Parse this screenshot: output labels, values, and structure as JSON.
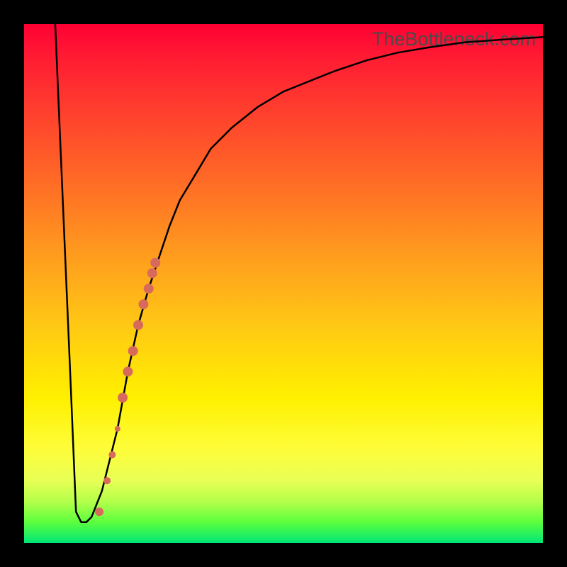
{
  "watermark": "TheBottleneck.com",
  "colors": {
    "frame": "#000000",
    "curve": "#000000",
    "marker": "#d86a5c"
  },
  "chart_data": {
    "type": "line",
    "title": "",
    "xlabel": "",
    "ylabel": "",
    "xlim": [
      0,
      100
    ],
    "ylim": [
      0,
      100
    ],
    "series": [
      {
        "name": "bottleneck-curve",
        "x": [
          6,
          9,
          10,
          11,
          12,
          13,
          15,
          18,
          20,
          22,
          24,
          26,
          28,
          30,
          33,
          36,
          40,
          45,
          50,
          55,
          60,
          66,
          72,
          78,
          85,
          92,
          100
        ],
        "values": [
          100,
          30,
          6,
          4,
          4,
          5,
          10,
          22,
          33,
          42,
          49,
          55,
          61,
          66,
          71,
          76,
          80,
          84,
          87,
          89,
          91,
          93,
          94.5,
          95.5,
          96.5,
          97,
          97.5
        ]
      }
    ],
    "markers": {
      "name": "highlighted-segment",
      "x": [
        14.5,
        16,
        17,
        18,
        19,
        20,
        21,
        22,
        23,
        24,
        24.7,
        25.3
      ],
      "values": [
        6,
        12,
        17,
        22,
        28,
        33,
        37,
        42,
        46,
        49,
        52,
        54
      ],
      "radius": [
        6,
        5,
        5,
        4,
        7,
        7,
        7,
        7,
        7,
        7,
        7,
        7
      ]
    }
  }
}
